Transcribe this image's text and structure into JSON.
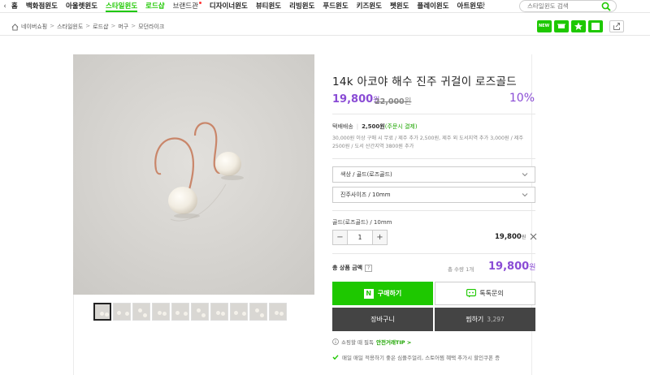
{
  "nav": {
    "items": [
      {
        "label": "홈",
        "style": "normal"
      },
      {
        "label": "백화점윈도",
        "style": "normal"
      },
      {
        "label": "아울렛윈도",
        "style": "normal"
      },
      {
        "label": "스타일윈도",
        "style": "active"
      },
      {
        "label": "로드샵",
        "style": "green"
      },
      {
        "label": "브랜드관",
        "style": "brand"
      },
      {
        "label": "디자이너윈도",
        "style": "normal"
      },
      {
        "label": "뷰티윈도",
        "style": "normal"
      },
      {
        "label": "리빙윈도",
        "style": "normal"
      },
      {
        "label": "푸드윈도",
        "style": "normal"
      },
      {
        "label": "키즈윈도",
        "style": "normal"
      },
      {
        "label": "펫윈도",
        "style": "normal"
      },
      {
        "label": "플레이윈도",
        "style": "normal"
      },
      {
        "label": "아트윈도",
        "style": "normal"
      }
    ],
    "more_label": "핫",
    "search_placeholder": "스타일윈도 검색"
  },
  "breadcrumb": {
    "items": [
      "네이버쇼핑",
      "스타일윈도",
      "로드샵",
      "머구",
      "모던라이크"
    ],
    "sep": ">"
  },
  "share": {
    "first_badge": "NEW"
  },
  "product": {
    "title": "14k 아코야 해수 진주 귀걸이 로즈골드",
    "sale_price": "19,800",
    "won": "원",
    "original_price": "22,000",
    "discount": "10%",
    "shipping": {
      "label": "택배배송",
      "fee": "2,500원",
      "when": "(주문시 결제)",
      "desc": "30,000원 이상 구매 시 무료 / 제주 추가 2,500원, 제주 외 도서지역 추가 3,000원 / 제주 2500원 / 도서 산간지역 3800원 추가"
    },
    "option1": "색상 / 골드(로즈골드)",
    "option2": "진주사이즈 / 10mm",
    "selected_option": "골드(로즈골드) / 10mm",
    "quantity": "1",
    "minus": "−",
    "plus": "+",
    "line_price": "19,800",
    "total_label": "총 상품 금액",
    "total_qty": "총 수량 1개",
    "total_price": "19,800",
    "buy_label": "구매하기",
    "talk_label": "톡톡문의",
    "cart_label": "장바구니",
    "wish_label": "찜하기",
    "wish_count": "3,297",
    "safe_note": "쇼핑할 때 필독",
    "safe_tip": "안전거래TIP >",
    "benefit_note": "매일 매일 적용하기 좋은 심플주얼리, 스토어찜 혜택 추가시 할인쿠폰 증"
  },
  "colors": {
    "naver_green": "#1ec800",
    "price_purple": "#8a4cd5",
    "dark_button": "#444444"
  }
}
